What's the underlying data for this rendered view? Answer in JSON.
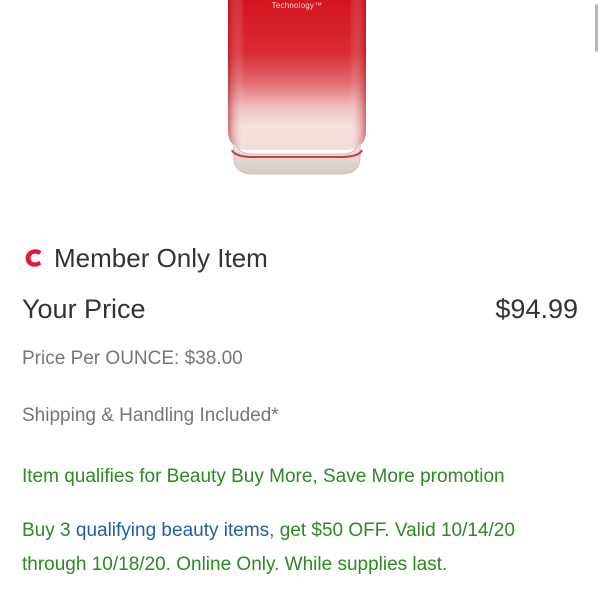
{
  "product": {
    "image_label": "Technology™"
  },
  "member": {
    "icon": "costco-c-icon",
    "text": "Member Only Item"
  },
  "price": {
    "label": "Your Price",
    "value": "$94.99",
    "per_unit": "Price Per OUNCE: $38.00",
    "shipping": "Shipping & Handling Included*"
  },
  "promotion": {
    "title": "Item qualifies for Beauty Buy More, Save More promotion",
    "detail_prefix": "Buy 3 ",
    "link_text": "qualifying beauty items",
    "detail_suffix": ", get $50 OFF. Valid 10/14/20 through 10/18/20. Online Only. While supplies last."
  },
  "colors": {
    "brand_red": "#e31837",
    "promo_green": "#2b8a20",
    "link_blue": "#1f5fae",
    "text_dark": "#333333",
    "text_gray": "#767676"
  }
}
